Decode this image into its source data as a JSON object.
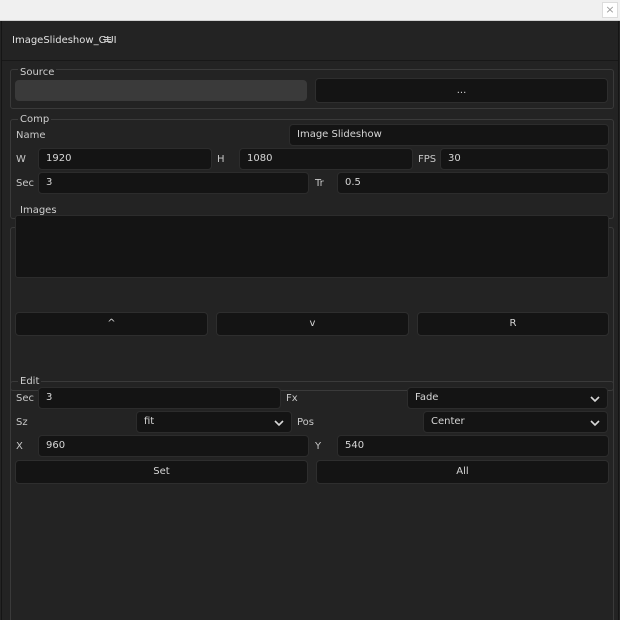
{
  "window": {
    "close_glyph": "×"
  },
  "panel": {
    "title": "ImageSlideshow_GUI",
    "menu_glyph": "≡"
  },
  "source": {
    "label": "Source",
    "path_value": "",
    "browse_label": "..."
  },
  "comp": {
    "label": "Comp",
    "name_label": "Name",
    "name_value": "Image Slideshow",
    "w_label": "W",
    "w_value": "1920",
    "h_label": "H",
    "h_value": "1080",
    "fps_label": "FPS",
    "fps_value": "30",
    "sec_label": "Sec",
    "sec_value": "3",
    "tr_label": "Tr",
    "tr_value": "0.5"
  },
  "images": {
    "label": "Images",
    "items": [],
    "up_label": "^",
    "down_label": "v",
    "remove_label": "R"
  },
  "edit": {
    "label": "Edit",
    "sec_label": "Sec",
    "sec_value": "3",
    "fx_label": "Fx",
    "fx_value": "Fade",
    "sz_label": "Sz",
    "sz_value": "fit",
    "pos_label": "Pos",
    "pos_value": "Center",
    "x_label": "X",
    "x_value": "960",
    "y_label": "Y",
    "y_value": "540",
    "set_label": "Set",
    "all_label": "All"
  },
  "colors": {
    "background": "#232323",
    "field": "#141414",
    "border": "#3a3a3a",
    "text": "#c8c8c8"
  }
}
